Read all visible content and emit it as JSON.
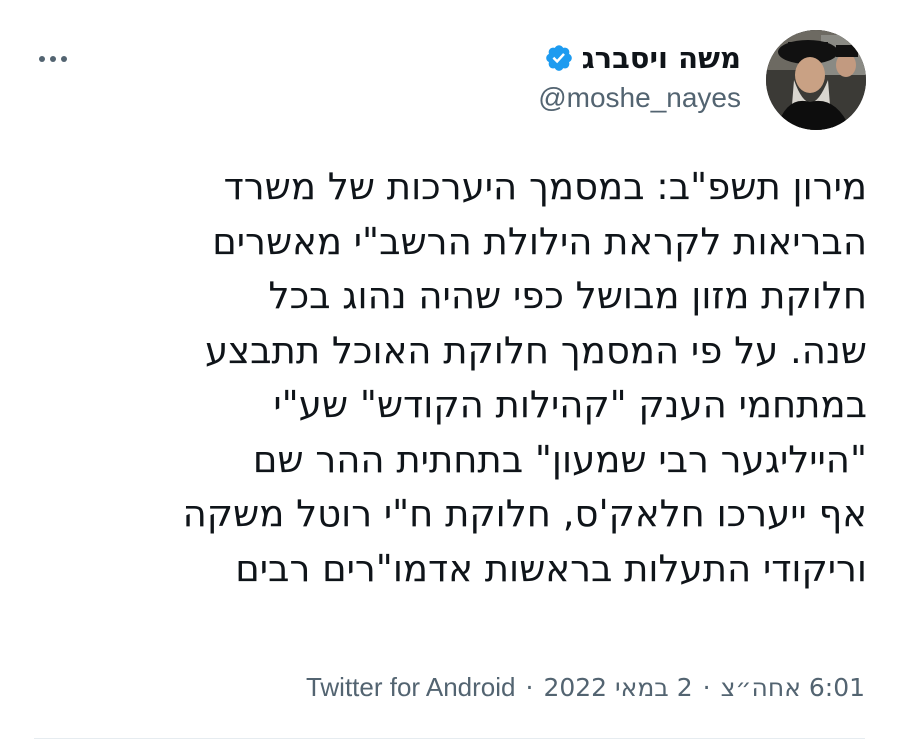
{
  "tweet": {
    "author": {
      "display_name": "משה ויסברג",
      "handle": "@moshe_nayes",
      "verified": true,
      "avatar_icon": "profile-photo"
    },
    "menu_icon": "more-horizontal-icon",
    "text": "מירון תשפ\"ב: במסמך היערכות של משרד\nהבריאות לקראת הילולת הרשב\"י מאשרים\nחלוקת מזון מבושל כפי שהיה נהוג בכל\nשנה. על פי המסמך חלוקת האוכל תתבצע\nבמתחמי הענק \"קהילות הקודש\" שע\"י\n\"הייליגער רבי שמעון\" בתחתית ההר שם\nאף ייערכו חלאק'ס, חלוקת ח\"י רוטל משקה\nוריקודי התעלות בראשות אדמו\"רים רבים",
    "meta": {
      "time": "6:01 אחה״צ",
      "date": "2 במאי 2022",
      "source": "Twitter for Android",
      "separator": "·"
    }
  },
  "colors": {
    "text_primary": "#0f1419",
    "text_secondary": "#536471",
    "verified_blue": "#1d9bf0",
    "divider": "#e6ecf0"
  }
}
